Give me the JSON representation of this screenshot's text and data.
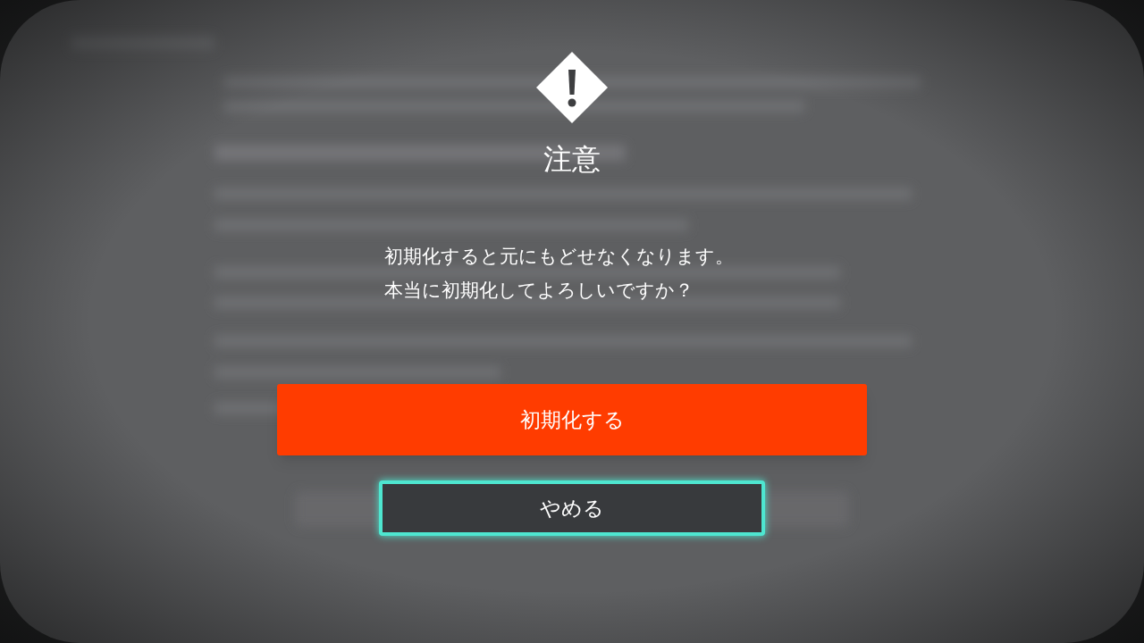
{
  "dialog": {
    "title": "注意",
    "message": [
      "初期化すると元にもどせなくなります。",
      "本当に初期化してよろしいですか？"
    ],
    "buttons": [
      {
        "label": "初期化する",
        "kind": "primary",
        "selected": false
      },
      {
        "label": "やめる",
        "kind": "secondary",
        "selected": true
      }
    ]
  }
}
